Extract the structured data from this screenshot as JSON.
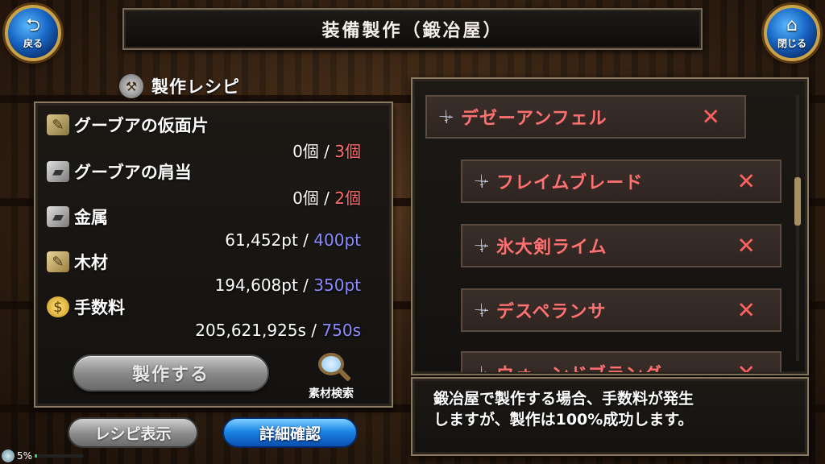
{
  "header": {
    "title": "装備製作（鍛冶屋）",
    "back_label": "戻る",
    "close_label": "閉じる"
  },
  "recipe": {
    "heading": "製作レシピ",
    "materials": [
      {
        "icon": "horn-fragment-icon",
        "name": "グーブアの仮面片",
        "have": "0個",
        "sep": " / ",
        "need": "3個",
        "need_color": "red"
      },
      {
        "icon": "ingot-icon",
        "name": "グーブアの肩当",
        "have": "0個",
        "sep": " / ",
        "need": "2個",
        "need_color": "red"
      },
      {
        "icon": "ingot-icon",
        "name": "金属",
        "have": "61,452pt",
        "sep": " / ",
        "need": "400pt",
        "need_color": "blue"
      },
      {
        "icon": "wood-icon",
        "name": "木材",
        "have": "194,608pt",
        "sep": " / ",
        "need": "350pt",
        "need_color": "blue"
      },
      {
        "icon": "coin-icon",
        "name": "手数料",
        "have": "205,621,925s",
        "sep": " / ",
        "need": "750s",
        "need_color": "blue"
      }
    ],
    "craft_button": "製作する",
    "search_label": "素材検索"
  },
  "bottom_buttons": {
    "recipe_view": "レシピ表示",
    "detail_check": "詳細確認"
  },
  "equipment_list": [
    {
      "name": "デゼーアンフェル",
      "remove": "✕"
    },
    {
      "name": "フレイムブレード",
      "remove": "✕"
    },
    {
      "name": "氷大剣ライム",
      "remove": "✕"
    },
    {
      "name": "デスペランサ",
      "remove": "✕"
    },
    {
      "name": "ウォーンドブラング",
      "remove": "✕"
    }
  ],
  "message": {
    "line1": "鍛冶屋で製作する場合、手数料が発生",
    "line2": "しますが、製作は100%成功します。"
  },
  "status": {
    "percent": "5%",
    "bar_fraction": 0.05
  },
  "colors": {
    "need_red": "#ff6b6b",
    "need_blue": "#8b8bff",
    "item_name": "#ff7070",
    "detail_button": "#1c86e6"
  }
}
